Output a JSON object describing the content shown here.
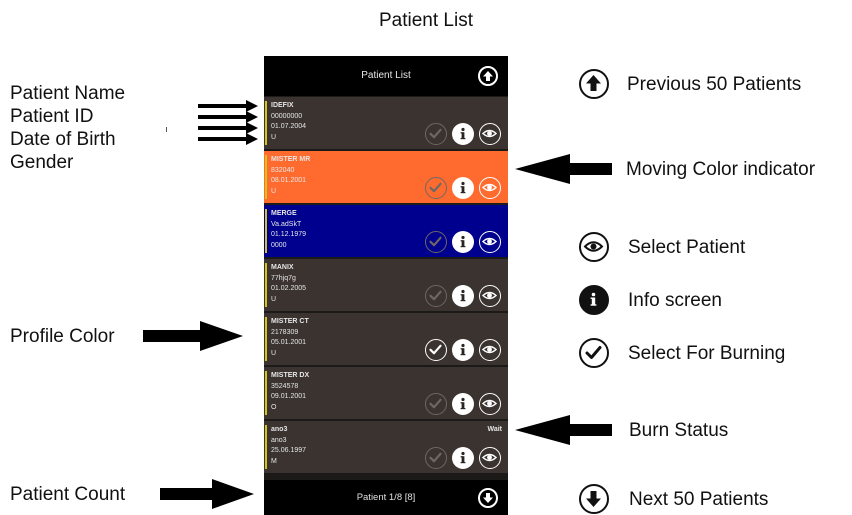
{
  "title": "Patient List",
  "phone": {
    "header_title": "Patient List",
    "footer_text": "Patient 1/8 [8]",
    "header_bg": "#000000",
    "row_bg": "#3a3330",
    "profile_bar_color": "#d6c41a",
    "patients": [
      {
        "name": "IDEFIX",
        "id": "00000000",
        "dob": "01.07.2004",
        "gender": "U",
        "bg": "#3a3330",
        "selected_for_burning": false,
        "status": ""
      },
      {
        "name": "MISTER MR",
        "id": "832040",
        "dob": "08.01.2001",
        "gender": "U",
        "bg": "#ff6b2e",
        "selected_for_burning": false,
        "status": ""
      },
      {
        "name": "MERGE",
        "id": "Va.adSkT",
        "dob": "01.12.1979",
        "gender": "0000",
        "bg": "#00008e",
        "selected_for_burning": false,
        "status": ""
      },
      {
        "name": "MANIX",
        "id": "77hjq7g",
        "dob": "01.02.2005",
        "gender": "U",
        "bg": "#3a3330",
        "selected_for_burning": false,
        "status": ""
      },
      {
        "name": "MISTER CT",
        "id": "2178309",
        "dob": "05.01.2001",
        "gender": "U",
        "bg": "#3a3330",
        "selected_for_burning": true,
        "status": ""
      },
      {
        "name": "MISTER DX",
        "id": "3524578",
        "dob": "09.01.2001",
        "gender": "O",
        "bg": "#3a3330",
        "selected_for_burning": false,
        "status": ""
      },
      {
        "name": "ano3",
        "id": "ano3",
        "dob": "25.06.1997",
        "gender": "M",
        "bg": "#3a3330",
        "selected_for_burning": false,
        "status": "Wait"
      }
    ]
  },
  "annotations": {
    "left": {
      "patient_name": "Patient Name",
      "patient_id": "Patient ID",
      "date_of_birth": "Date of Birth",
      "gender": "Gender",
      "profile_color": "Profile Color",
      "patient_count": "Patient Count"
    },
    "right": {
      "previous_50": "Previous 50 Patients",
      "moving_color": "Moving Color indicator",
      "select_patient": "Select Patient",
      "info_screen": "Info screen",
      "select_for_burning": "Select For Burning",
      "burn_status": "Burn Status",
      "next_50": "Next 50 Patients"
    }
  },
  "icons": {
    "up": "arrow-up-circle-icon",
    "down": "arrow-down-circle-icon",
    "check": "check-circle-icon",
    "info": "info-circle-icon",
    "eye": "eye-circle-icon"
  }
}
